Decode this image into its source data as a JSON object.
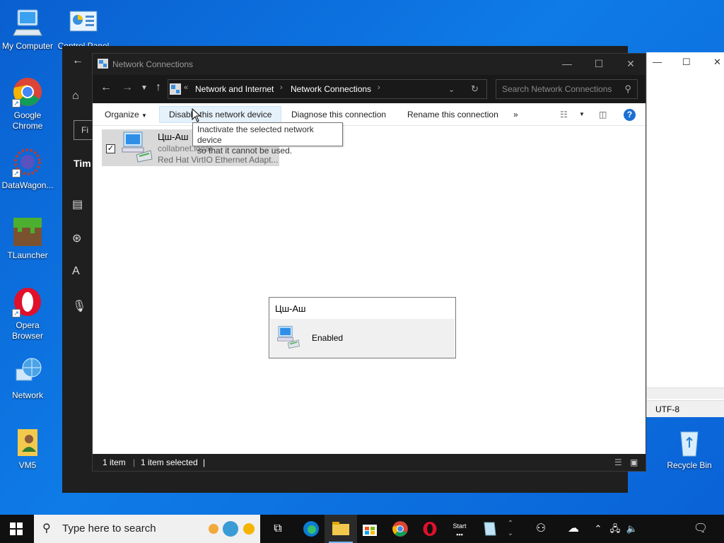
{
  "desktop": {
    "icons": [
      {
        "label": "My Computer",
        "icon": "monitor-icon"
      },
      {
        "label": "Control Panel",
        "icon": "control-panel-icon"
      },
      {
        "label": "Google Chrome",
        "icon": "chrome-icon"
      },
      {
        "label": "DataWagon...",
        "icon": "datawagon-icon"
      },
      {
        "label": "TLauncher",
        "icon": "grass-block-icon"
      },
      {
        "label": "Opera Browser",
        "icon": "opera-icon"
      },
      {
        "label": "Network",
        "icon": "network-globe-icon"
      },
      {
        "label": "VM5",
        "icon": "user-folder-icon"
      },
      {
        "label": "Recycle Bin",
        "icon": "recycle-bin-icon"
      }
    ]
  },
  "settings_window": {
    "find_text": "Fi",
    "section_text": "Tim"
  },
  "right_window": {
    "encoding": "UTF-8"
  },
  "explorer": {
    "title": "Network Connections",
    "breadcrumb": [
      "Network and Internet",
      "Network Connections"
    ],
    "search_placeholder": "Search Network Connections",
    "commands": {
      "organize": "Organize",
      "disable": "Disable this network device",
      "diagnose": "Diagnose this connection",
      "rename": "Rename this connection",
      "more": "»"
    },
    "tooltip": {
      "line1": "Inactivate the selected network device",
      "line2": "so that it cannot be used."
    },
    "item": {
      "name": "Цш-Аш",
      "domain": "collabnet.local",
      "adapter": "Red Hat VirtIO Ethernet Adapt..."
    },
    "popup": {
      "title": "Цш-Аш",
      "status": "Enabled"
    },
    "status": {
      "count": "1 item",
      "selected": "1 item selected"
    }
  },
  "taskbar": {
    "search_placeholder": "Type here to search"
  },
  "colors": {
    "desktop_bg": "#0a5fd0",
    "titlebar_bg": "#202020",
    "accent": "#1a6fd6",
    "selection": "#d9d9d9"
  }
}
